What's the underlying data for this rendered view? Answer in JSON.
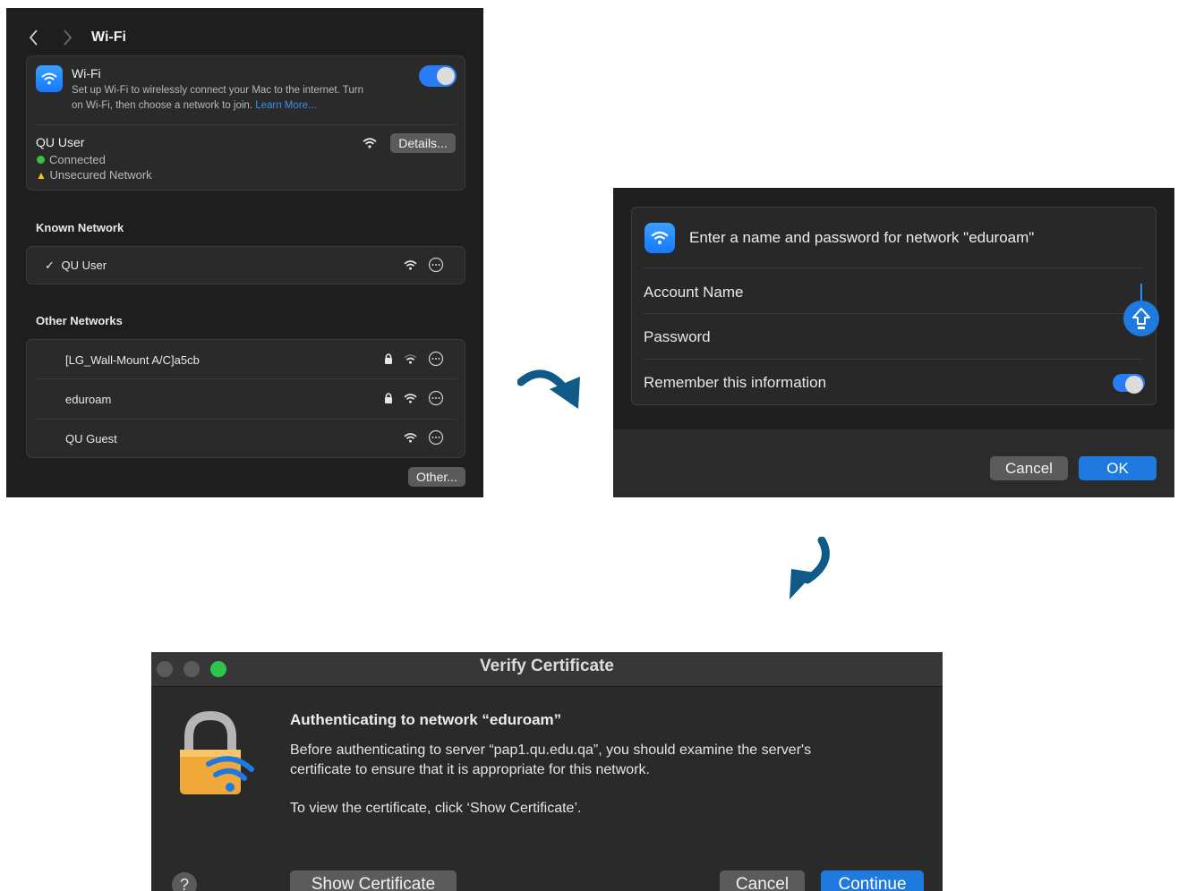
{
  "wifi_settings": {
    "title": "Wi-Fi",
    "wifi_card": {
      "label": "Wi-Fi",
      "description_line1": "Set up Wi-Fi to wirelessly connect your Mac to the internet. Turn",
      "description_line2": "on Wi-Fi, then choose a network to join.",
      "learn_more": "Learn More...",
      "toggle_on": true
    },
    "current_network": {
      "name": "QU User",
      "status": "Connected",
      "warning": "Unsecured Network",
      "details_button": "Details..."
    },
    "known_header": "Known Network",
    "known_networks": [
      {
        "check": "✓",
        "name": "QU User"
      }
    ],
    "other_header": "Other Networks",
    "other_networks": [
      {
        "name": "[LG_Wall-Mount A/C]a5cb",
        "locked": true
      },
      {
        "name": "eduroam",
        "locked": true
      },
      {
        "name": "QU Guest",
        "locked": false
      }
    ],
    "other_button": "Other..."
  },
  "password_dialog": {
    "title": "Enter a name and password for network \"eduroam\"",
    "account_label": "Account Name",
    "password_label": "Password",
    "remember_label": "Remember this information",
    "remember_on": true,
    "cancel_button": "Cancel",
    "ok_button": "OK"
  },
  "verify_certificate": {
    "window_title": "Verify Certificate",
    "heading": "Authenticating to network “eduroam”",
    "body_line1": "Before authenticating to server “pap1.qu.edu.qa”, you should examine the server's",
    "body_line2": "certificate to ensure that it is appropriate for this network.",
    "body_line3": "To view the certificate, click ‘Show Certificate’.",
    "help_button": "?",
    "show_certificate_button": "Show Certificate",
    "cancel_button": "Cancel",
    "continue_button": "Continue"
  },
  "colors": {
    "accent_blue": "#1f7ae0",
    "arrow_blue": "#0f5a86",
    "connected_green": "#32c24d",
    "warning_yellow": "#f5c518"
  }
}
